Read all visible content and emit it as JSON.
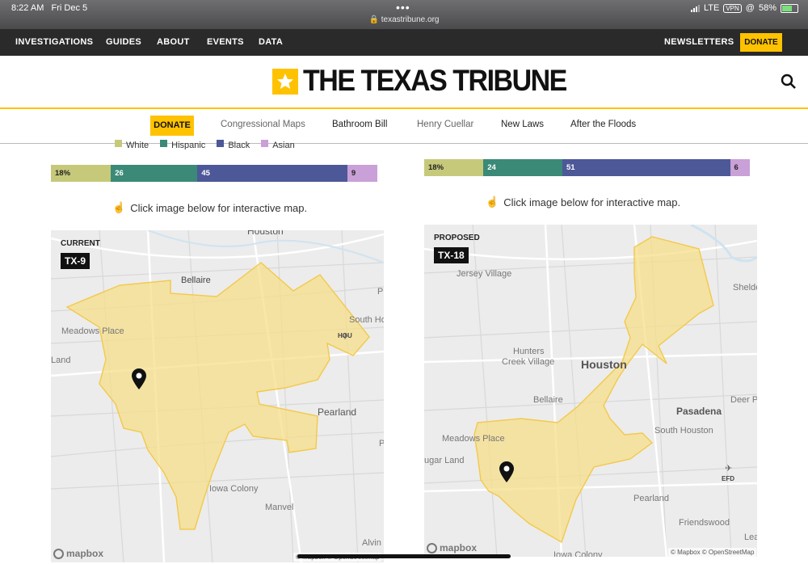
{
  "status": {
    "time": "8:22 AM",
    "date": "Fri Dec 5",
    "url": "texastribune.org",
    "network": "LTE",
    "vpn": "VPN",
    "battery": "58%"
  },
  "topnav": {
    "items": [
      "INVESTIGATIONS",
      "GUIDES",
      "ABOUT",
      "EVENTS",
      "DATA"
    ],
    "newsletters": "NEWSLETTERS",
    "donate": "DONATE"
  },
  "masthead": {
    "title": "THE TEXAS TRIBUNE",
    "search_icon": "search-icon"
  },
  "subnav": {
    "donate": "DONATE",
    "items": [
      "Congressional Maps",
      "Bathroom Bill",
      "Henry Cuellar",
      "New Laws",
      "After the Floods"
    ]
  },
  "legend": {
    "white": "White",
    "hispanic": "Hispanic",
    "black": "Black",
    "asian": "Asian"
  },
  "colors": {
    "white": "#c6c97a",
    "hispanic": "#3a8a77",
    "black": "#4c5898",
    "asian": "#c9a0d8",
    "district_fill": "#f7df8a",
    "accent": "#ffc200"
  },
  "left": {
    "bar": [
      "18%",
      "26",
      "45",
      "9"
    ],
    "bar_values": [
      18,
      26,
      45,
      9
    ],
    "hint": "Click image below for interactive map.",
    "map_label": "CURRENT",
    "district": "TX-9",
    "places": [
      "Houston",
      "Bellaire",
      "Meadows Place",
      "South Ho",
      "HOU",
      "Pearland",
      "Iowa Colony",
      "Manvel",
      "Alvin",
      "Land",
      "P",
      "P"
    ],
    "logo": "mapbox",
    "attribution": "© Mapbox © OpenStreetMap"
  },
  "right": {
    "bar": [
      "18%",
      "24",
      "51",
      "6"
    ],
    "bar_values": [
      18,
      24,
      51,
      6
    ],
    "hint": "Click image below for interactive map.",
    "map_label": "PROPOSED",
    "district": "TX-18",
    "places": [
      "Jersey Village",
      "Hunters",
      "Creek Village",
      "Houston",
      "Bellaire",
      "Pasadena",
      "South Houston",
      "Deer P",
      "Meadows Place",
      "ugar Land",
      "EFD",
      "Pearland",
      "Friendswood",
      "Iowa Colony",
      "Shelde",
      "Lea"
    ],
    "logo": "mapbox",
    "attribution": "© Mapbox © OpenStreetMap"
  }
}
